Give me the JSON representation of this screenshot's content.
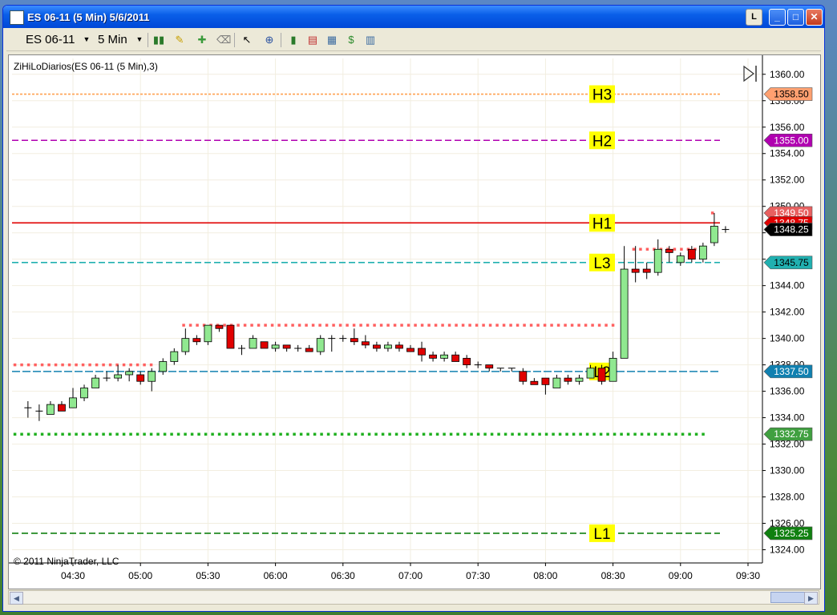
{
  "window": {
    "title": "ES 06-11 (5 Min)  5/6/2011",
    "buttons": {
      "l": "L",
      "min": "_",
      "max": "□",
      "close": "✕"
    }
  },
  "toolbar": {
    "instrument": "ES 06-11",
    "interval": "5 Min",
    "icons": [
      "bar-chart-icon",
      "pencil-icon",
      "add-indicator-icon",
      "pointer-icon",
      "zoom-icon",
      "bar-style-icon",
      "chart-style-icon",
      "dollar-icon",
      "properties-icon"
    ]
  },
  "chart": {
    "indicator_label": "ZiHiLoDiarios(ES 06-11 (5 Min),3)",
    "copyright": "© 2011 NinjaTrader, LLC"
  },
  "colors": {
    "up": "#90e890",
    "down": "#e00000",
    "grid": "#f2eee0",
    "H3": "#ffa050",
    "H2": "#b000b0",
    "H1": "#e00000",
    "L3": "#20b0b0",
    "L2": "#1080b0",
    "L1": "#108010",
    "dots_red": "#ff6060",
    "dots_green": "#20b020"
  },
  "chart_data": {
    "type": "candlestick",
    "xlabel": "",
    "ylabel": "",
    "ylim": [
      1323,
      1361.2
    ],
    "x_ticks": [
      "04:30",
      "05:00",
      "05:30",
      "06:00",
      "06:30",
      "07:00",
      "07:30",
      "08:00",
      "08:30",
      "09:00",
      "09:30"
    ],
    "y_ticks": [
      1360,
      1358,
      1356,
      1354,
      1352,
      1350,
      1348,
      1346,
      1344,
      1342,
      1340,
      1338,
      1336,
      1334,
      1332,
      1330,
      1328,
      1326,
      1324
    ],
    "y_tick_labels": [
      "1360.00",
      "1358.00",
      "1356.00",
      "1354.00",
      "1352.00",
      "1350.00",
      "",
      "",
      "1344.00",
      "1342.00",
      "1340.00",
      "1338.00",
      "1336.00",
      "1334.00",
      "1332.00",
      "1330.00",
      "1328.00",
      "1326.00",
      "1324.00"
    ],
    "levels": [
      {
        "name": "H3",
        "value": 1358.5,
        "label": "1358.50",
        "color": "#ffa050",
        "dash": "3,2"
      },
      {
        "name": "H2",
        "value": 1355.0,
        "label": "1355.00",
        "color": "#b000b0",
        "dash": "8,4"
      },
      {
        "name": "H1",
        "value": 1348.75,
        "label": "1348.75",
        "color": "#e00000",
        "dash": ""
      },
      {
        "name": "L3",
        "value": 1345.75,
        "label": "1345.75",
        "color": "#20b0b0",
        "dash": "8,4"
      },
      {
        "name": "L2",
        "value": 1337.5,
        "label": "1337.50",
        "color": "#1080b0",
        "dash": "10,3"
      },
      {
        "name": "L1",
        "value": 1325.25,
        "label": "1325.25",
        "color": "#108010",
        "dash": "8,4"
      }
    ],
    "dotted_levels": [
      {
        "value": 1338.0,
        "from": "04:05",
        "to": "05:05",
        "color": "#ff6060"
      },
      {
        "value": 1341.0,
        "from": "05:20",
        "to": "08:30",
        "color": "#ff6060"
      },
      {
        "value": 1346.75,
        "from": "08:40",
        "to": "09:10",
        "color": "#ff6060"
      },
      {
        "value": 1349.5,
        "from": "09:15",
        "to": "09:15",
        "color": "#ff6060"
      },
      {
        "value": 1332.75,
        "from": "04:05",
        "to": "09:10",
        "color": "#20b020"
      }
    ],
    "price_markers": [
      {
        "label": "1349.50",
        "value": 1349.5,
        "bg": "#e86060",
        "fg": "#ffffff"
      },
      {
        "label": "1348.75",
        "value": 1348.75,
        "bg": "#e00000",
        "fg": "#ffffff"
      },
      {
        "label": "1348.25",
        "value": 1348.25,
        "bg": "#000000",
        "fg": "#ffffff"
      },
      {
        "label": "1358.50",
        "value": 1358.5,
        "bg": "#ffa070",
        "fg": "#000000"
      },
      {
        "label": "1355.00",
        "value": 1355.0,
        "bg": "#b000b0",
        "fg": "#ffffff"
      },
      {
        "label": "1345.75",
        "value": 1345.75,
        "bg": "#20b0b0",
        "fg": "#000000"
      },
      {
        "label": "1337.50",
        "value": 1337.5,
        "bg": "#1080b0",
        "fg": "#ffffff"
      },
      {
        "label": "1332.75",
        "value": 1332.75,
        "bg": "#40a040",
        "fg": "#ffffff"
      },
      {
        "label": "1325.25",
        "value": 1325.25,
        "bg": "#108010",
        "fg": "#ffffff"
      }
    ],
    "bars": [
      {
        "t": "04:10",
        "o": 1334.75,
        "h": 1335.25,
        "l": 1334.0,
        "c": 1334.75
      },
      {
        "t": "04:15",
        "o": 1334.5,
        "h": 1335.0,
        "l": 1333.75,
        "c": 1334.5
      },
      {
        "t": "04:20",
        "o": 1334.25,
        "h": 1335.25,
        "l": 1334.25,
        "c": 1335.0
      },
      {
        "t": "04:25",
        "o": 1335.0,
        "h": 1335.25,
        "l": 1334.5,
        "c": 1334.5
      },
      {
        "t": "04:30",
        "o": 1334.75,
        "h": 1336.25,
        "l": 1334.75,
        "c": 1335.5
      },
      {
        "t": "04:35",
        "o": 1335.5,
        "h": 1336.5,
        "l": 1335.25,
        "c": 1336.25
      },
      {
        "t": "04:40",
        "o": 1336.25,
        "h": 1337.25,
        "l": 1336.25,
        "c": 1337.0
      },
      {
        "t": "04:45",
        "o": 1337.0,
        "h": 1337.5,
        "l": 1336.75,
        "c": 1337.0
      },
      {
        "t": "04:50",
        "o": 1337.0,
        "h": 1338.0,
        "l": 1336.75,
        "c": 1337.25
      },
      {
        "t": "04:55",
        "o": 1337.25,
        "h": 1337.75,
        "l": 1336.75,
        "c": 1337.5
      },
      {
        "t": "05:00",
        "o": 1337.25,
        "h": 1337.5,
        "l": 1336.5,
        "c": 1336.75
      },
      {
        "t": "05:05",
        "o": 1336.75,
        "h": 1337.75,
        "l": 1336.0,
        "c": 1337.5
      },
      {
        "t": "05:10",
        "o": 1337.5,
        "h": 1338.5,
        "l": 1337.25,
        "c": 1338.25
      },
      {
        "t": "05:15",
        "o": 1338.25,
        "h": 1339.25,
        "l": 1338.0,
        "c": 1339.0
      },
      {
        "t": "05:20",
        "o": 1339.0,
        "h": 1340.75,
        "l": 1338.75,
        "c": 1340.0
      },
      {
        "t": "05:25",
        "o": 1340.0,
        "h": 1340.25,
        "l": 1339.5,
        "c": 1339.75
      },
      {
        "t": "05:30",
        "o": 1339.75,
        "h": 1341.0,
        "l": 1339.5,
        "c": 1341.0
      },
      {
        "t": "05:35",
        "o": 1341.0,
        "h": 1341.0,
        "l": 1340.5,
        "c": 1340.75
      },
      {
        "t": "05:40",
        "o": 1341.0,
        "h": 1341.0,
        "l": 1339.25,
        "c": 1339.25
      },
      {
        "t": "05:45",
        "o": 1339.25,
        "h": 1339.5,
        "l": 1338.75,
        "c": 1339.25
      },
      {
        "t": "05:50",
        "o": 1339.25,
        "h": 1340.25,
        "l": 1339.25,
        "c": 1340.0
      },
      {
        "t": "05:55",
        "o": 1339.75,
        "h": 1339.75,
        "l": 1339.25,
        "c": 1339.25
      },
      {
        "t": "06:00",
        "o": 1339.25,
        "h": 1339.75,
        "l": 1339.0,
        "c": 1339.5
      },
      {
        "t": "06:05",
        "o": 1339.5,
        "h": 1339.5,
        "l": 1339.0,
        "c": 1339.25
      },
      {
        "t": "06:10",
        "o": 1339.25,
        "h": 1339.5,
        "l": 1339.0,
        "c": 1339.25
      },
      {
        "t": "06:15",
        "o": 1339.25,
        "h": 1339.5,
        "l": 1339.0,
        "c": 1339.0
      },
      {
        "t": "06:20",
        "o": 1339.0,
        "h": 1340.25,
        "l": 1338.75,
        "c": 1340.0
      },
      {
        "t": "06:25",
        "o": 1340.0,
        "h": 1340.25,
        "l": 1339.0,
        "c": 1340.0
      },
      {
        "t": "06:30",
        "o": 1340.0,
        "h": 1340.25,
        "l": 1339.75,
        "c": 1340.0
      },
      {
        "t": "06:35",
        "o": 1340.0,
        "h": 1340.75,
        "l": 1339.5,
        "c": 1339.75
      },
      {
        "t": "06:40",
        "o": 1339.75,
        "h": 1340.25,
        "l": 1339.25,
        "c": 1339.5
      },
      {
        "t": "06:45",
        "o": 1339.5,
        "h": 1339.75,
        "l": 1339.0,
        "c": 1339.25
      },
      {
        "t": "06:50",
        "o": 1339.25,
        "h": 1339.75,
        "l": 1339.0,
        "c": 1339.5
      },
      {
        "t": "06:55",
        "o": 1339.5,
        "h": 1339.75,
        "l": 1339.0,
        "c": 1339.25
      },
      {
        "t": "07:00",
        "o": 1339.25,
        "h": 1339.5,
        "l": 1339.0,
        "c": 1339.0
      },
      {
        "t": "07:05",
        "o": 1339.25,
        "h": 1339.75,
        "l": 1338.25,
        "c": 1338.75
      },
      {
        "t": "07:10",
        "o": 1338.75,
        "h": 1339.0,
        "l": 1338.25,
        "c": 1338.5
      },
      {
        "t": "07:15",
        "o": 1338.5,
        "h": 1339.0,
        "l": 1338.25,
        "c": 1338.75
      },
      {
        "t": "07:20",
        "o": 1338.75,
        "h": 1339.0,
        "l": 1338.25,
        "c": 1338.25
      },
      {
        "t": "07:25",
        "o": 1338.5,
        "h": 1338.75,
        "l": 1337.75,
        "c": 1338.0
      },
      {
        "t": "07:30",
        "o": 1338.0,
        "h": 1338.25,
        "l": 1337.75,
        "c": 1338.0
      },
      {
        "t": "07:35",
        "o": 1338.0,
        "h": 1338.0,
        "l": 1337.5,
        "c": 1337.75
      },
      {
        "t": "07:40",
        "o": 1337.75,
        "h": 1337.75,
        "l": 1337.5,
        "c": 1337.75
      },
      {
        "t": "07:45",
        "o": 1337.75,
        "h": 1337.75,
        "l": 1337.5,
        "c": 1337.75
      },
      {
        "t": "07:50",
        "o": 1337.5,
        "h": 1337.75,
        "l": 1336.5,
        "c": 1336.75
      },
      {
        "t": "07:55",
        "o": 1336.75,
        "h": 1337.0,
        "l": 1336.5,
        "c": 1336.5
      },
      {
        "t": "08:00",
        "o": 1337.0,
        "h": 1337.0,
        "l": 1335.75,
        "c": 1336.5
      },
      {
        "t": "08:05",
        "o": 1336.25,
        "h": 1337.25,
        "l": 1336.25,
        "c": 1337.0
      },
      {
        "t": "08:10",
        "o": 1337.0,
        "h": 1337.25,
        "l": 1336.5,
        "c": 1336.75
      },
      {
        "t": "08:15",
        "o": 1336.75,
        "h": 1337.25,
        "l": 1336.5,
        "c": 1337.0
      },
      {
        "t": "08:20",
        "o": 1337.0,
        "h": 1338.0,
        "l": 1337.0,
        "c": 1337.75
      },
      {
        "t": "08:25",
        "o": 1337.75,
        "h": 1338.0,
        "l": 1336.5,
        "c": 1336.75
      },
      {
        "t": "08:30",
        "o": 1336.75,
        "h": 1339.0,
        "l": 1336.75,
        "c": 1338.5
      },
      {
        "t": "08:35",
        "o": 1338.5,
        "h": 1347.0,
        "l": 1338.5,
        "c": 1345.25
      },
      {
        "t": "08:40",
        "o": 1345.25,
        "h": 1347.0,
        "l": 1344.25,
        "c": 1345.0
      },
      {
        "t": "08:45",
        "o": 1345.25,
        "h": 1345.75,
        "l": 1344.5,
        "c": 1345.0
      },
      {
        "t": "08:50",
        "o": 1345.0,
        "h": 1347.5,
        "l": 1344.75,
        "c": 1346.75
      },
      {
        "t": "08:55",
        "o": 1346.75,
        "h": 1347.0,
        "l": 1345.75,
        "c": 1346.5
      },
      {
        "t": "09:00",
        "o": 1345.75,
        "h": 1346.5,
        "l": 1345.5,
        "c": 1346.25
      },
      {
        "t": "09:05",
        "o": 1346.75,
        "h": 1347.0,
        "l": 1345.75,
        "c": 1346.0
      },
      {
        "t": "09:10",
        "o": 1346.0,
        "h": 1347.25,
        "l": 1345.75,
        "c": 1347.0
      },
      {
        "t": "09:15",
        "o": 1347.25,
        "h": 1349.5,
        "l": 1347.0,
        "c": 1348.5
      },
      {
        "t": "09:20",
        "o": 1348.25,
        "h": 1348.5,
        "l": 1348.0,
        "c": 1348.25
      }
    ]
  }
}
